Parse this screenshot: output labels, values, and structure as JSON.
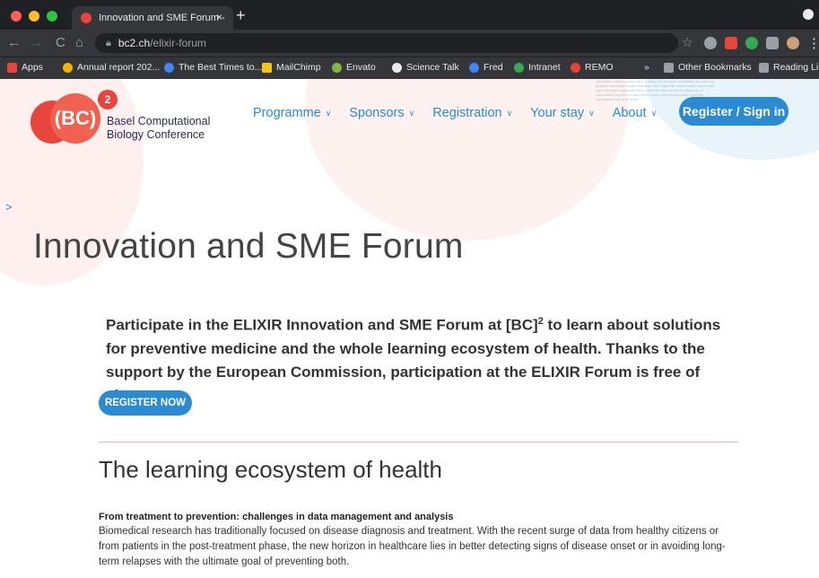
{
  "browser": {
    "tab_title": "Innovation and SME Forum -",
    "tab_close": "×",
    "new_tab": "+",
    "url_host": "bc2.ch",
    "url_path": "/elixir-forum",
    "back": "←",
    "forward": "→",
    "reload": "C",
    "home": "⌂",
    "star": "☆",
    "bookmarks": [
      {
        "label": "Apps",
        "color": "#e8453c"
      },
      {
        "label": "Annual report 202...",
        "color": "#f4b400"
      },
      {
        "label": "The Best Times to...",
        "color": "#4285f4"
      },
      {
        "label": "MailChimp",
        "color": "#f5c518"
      },
      {
        "label": "Envato",
        "color": "#82b541"
      },
      {
        "label": "Science Talk",
        "color": "#e8eaed"
      },
      {
        "label": "Fred",
        "color": "#4285f4"
      },
      {
        "label": "Intranet",
        "color": "#34a853"
      },
      {
        "label": "REMO",
        "color": "#ea4335"
      }
    ],
    "bookmarks_more": "»",
    "other_bookmarks": "Other Bookmarks",
    "reading_list": "Reading List"
  },
  "site": {
    "logo_text_line1": "Basel Computational",
    "logo_text_line2": "Biology Conference",
    "logo_mark": "(BC)",
    "logo_sup": "2",
    "nav": [
      {
        "label": "Programme"
      },
      {
        "label": "Sponsors"
      },
      {
        "label": "Registration"
      },
      {
        "label": "Your stay"
      },
      {
        "label": "About"
      }
    ],
    "register_signin": "Register / Sign in",
    "side_toggle": ">"
  },
  "content": {
    "title": "Innovation and SME Forum",
    "lead_part1": "Participate in the ELIXIR Innovation and SME Forum at [BC]",
    "lead_sup": "2",
    "lead_part2": " to learn about solutions for preventive medicine and the whole learning ecosystem of health. Thanks to the support by the European Commission, participation at the ELIXIR Forum is free of charge.",
    "cta": "REGISTER NOW",
    "section_title": "The learning ecosystem of health",
    "subhead": "From treatment to prevention: challenges in data management and analysis",
    "body": "Biomedical research has traditionally focused on disease diagnosis and treatment. With the recent surge of data from healthy citizens or from patients in the post-treatment phase, the new horizon in healthcare lies in better detecting signs of disease onset or in avoiding long-term relapses with the ultimate goal of preventing both."
  },
  "colors": {
    "accent": "#2a8bd3",
    "brand_red": "#e8453c",
    "divider": "#f2b3aa"
  }
}
